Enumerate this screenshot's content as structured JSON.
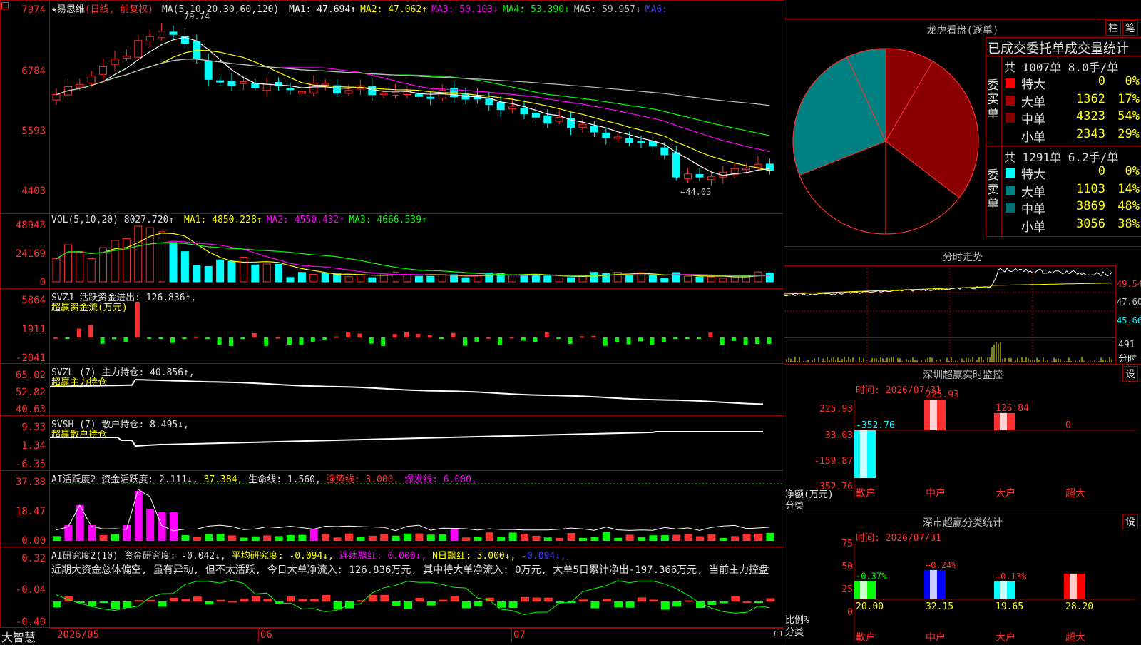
{
  "app": {
    "name": "大智慧"
  },
  "main_chart": {
    "stock_label": "★易思维",
    "period": "(日线, 前复权)",
    "ma_label": "MA(5,10,20,30,60,120)",
    "ma_values": [
      {
        "text": "MA1: 47.694↑",
        "color": "#ffffff"
      },
      {
        "text": "MA2: 47.062↑",
        "color": "#ffff00"
      },
      {
        "text": "MA3: 50.103↓",
        "color": "#ff00ff"
      },
      {
        "text": "MA4: 53.390↓",
        "color": "#00ff00"
      },
      {
        "text": "MA5: 59.957↓",
        "color": "#c0c0c0"
      },
      {
        "text": "MA6:",
        "color": "#4040ff"
      }
    ],
    "y_labels": [
      "7974",
      "6784",
      "5593",
      "4403"
    ],
    "high_mark": "79.74",
    "low_mark": "←44.03"
  },
  "vol_panel": {
    "label": "VOL(5,10,20)",
    "value": "8027.720↑",
    "ma": [
      {
        "text": "MA1: 4850.228↑",
        "color": "#ffff00"
      },
      {
        "text": "MA2: 4550.432↑",
        "color": "#ff00ff"
      },
      {
        "text": "MA3: 4666.539↑",
        "color": "#00ff00"
      }
    ],
    "y_labels": [
      "48943",
      "24169",
      "0"
    ]
  },
  "svzj_panel": {
    "label": "SVZJ  活跃资金进出: 126.836↑,",
    "sub": "超赢资金流(万元)",
    "y_labels": [
      "5864",
      "1911",
      "-2041"
    ]
  },
  "svzl_panel": {
    "label": "SVZL (7) 主力持仓: 40.856↑,",
    "sub": "超赢主力持仓",
    "y_labels": [
      "65.02",
      "52.82",
      "40.63"
    ]
  },
  "svsh_panel": {
    "label": "SVSH (7) 散户持仓: 8.495↓,",
    "sub": "超赢散户持仓",
    "y_labels": [
      "9.33",
      "1.34",
      "-6.35"
    ]
  },
  "ai_active": {
    "label": "AI活跃度2 资金活跃度: 2.111↓,",
    "v2": "37.384,",
    "v3": "生命线: 1.560,",
    "v4": "强势线: 3.000,",
    "v5": "爆发线: 6.000,",
    "y_labels": [
      "37.38",
      "18.47",
      "0.00"
    ]
  },
  "ai_research": {
    "label": "AI研究度2(10) 资金研究度: -0.042↓,",
    "v2": "平均研究度: -0.094↓,",
    "v3": "连续飘红: 0.000↓,",
    "v4": "N日飘红: 3.000↓,",
    "v5": "-0.094↓,",
    "note": "近期大资金总体偏空, 虽有异动, 但不太活跃, 今日大单净流入: 126.836万元, 其中特大单净流入: 0万元, 大单5日累计净出-197.366万元, 当前主力控盘",
    "y_labels": [
      "0.32",
      "-0.04",
      "-0.40"
    ]
  },
  "x_axis": {
    "labels": [
      "2026/05",
      "06",
      "07"
    ]
  },
  "longhu": {
    "title": "龙虎看盘(逐单)",
    "btn1": "柱",
    "btn2": "笔",
    "heading": "已成交委托单成交量统计",
    "buy": {
      "side_label": "委买单",
      "summary": "共 1007单 8.0手/单",
      "rows": [
        {
          "name": "特大",
          "count": "0",
          "pct": "0%",
          "color": "#ff0000"
        },
        {
          "name": "大单",
          "count": "1362",
          "pct": "17%",
          "color": "#a00000"
        },
        {
          "name": "中单",
          "count": "4323",
          "pct": "54%",
          "color": "#800000"
        },
        {
          "name": "小单",
          "count": "2343",
          "pct": "29%",
          "color": "#000000"
        }
      ]
    },
    "sell": {
      "side_label": "委卖单",
      "summary": "共 1291单 6.2手/单",
      "rows": [
        {
          "name": "特大",
          "count": "0",
          "pct": "0%",
          "color": "#00ffff"
        },
        {
          "name": "大单",
          "count": "1103",
          "pct": "14%",
          "color": "#008080"
        },
        {
          "name": "中单",
          "count": "3869",
          "pct": "48%",
          "color": "#007070"
        },
        {
          "name": "小单",
          "count": "3056",
          "pct": "38%",
          "color": "#000000"
        }
      ]
    }
  },
  "intraday": {
    "title": "分时走势",
    "y_labels": [
      "49.54",
      "47.60",
      "45.66"
    ],
    "vol_label": "491",
    "vol_unit": "分时"
  },
  "sz_monitor": {
    "title": "深圳超赢实时监控",
    "btn": "设",
    "time": "时间: 2026/07/31",
    "y_labels": [
      "225.93",
      "33.03",
      "-159.87",
      "-352.76"
    ],
    "unit_label": "净额(万元)",
    "cat_label": "分类",
    "bars": [
      {
        "name": "散户",
        "value": -352.76,
        "label": "-352.76",
        "color": "#00ffff"
      },
      {
        "name": "中户",
        "value": 225.93,
        "label": "225.93",
        "color": "#ff3030"
      },
      {
        "name": "大户",
        "value": 126.84,
        "label": "126.84",
        "color": "#ff3030"
      },
      {
        "name": "超大",
        "value": 0,
        "label": "0",
        "color": "#ffffff"
      }
    ]
  },
  "sz_category": {
    "title": "深市超赢分类统计",
    "btn": "设",
    "time": "时间: 2026/07/31",
    "y_labels": [
      "75",
      "50",
      "25",
      "0"
    ],
    "unit_label": "比例%",
    "cat_label": "分类",
    "bars": [
      {
        "name": "散户",
        "value": 20.0,
        "label": "20.00",
        "delta": "-0.37%",
        "color": "#00ff00"
      },
      {
        "name": "中户",
        "value": 32.15,
        "label": "32.15",
        "delta": "+0.24%",
        "color": "#0000ff"
      },
      {
        "name": "大户",
        "value": 19.65,
        "label": "19.65",
        "delta": "+0.13%",
        "color": "#00ffff"
      },
      {
        "name": "超大",
        "value": 28.2,
        "label": "28.20",
        "delta": "",
        "color": "#ff0000"
      }
    ]
  },
  "chart_data": {
    "type": "pie",
    "title": "龙虎看盘(逐单)",
    "categories": [
      "委买 大单",
      "委买 中单",
      "委买 小单",
      "委卖 小单",
      "委卖 中单",
      "委卖 大单"
    ],
    "values": [
      1362,
      4323,
      2343,
      3056,
      3869,
      1103
    ]
  }
}
